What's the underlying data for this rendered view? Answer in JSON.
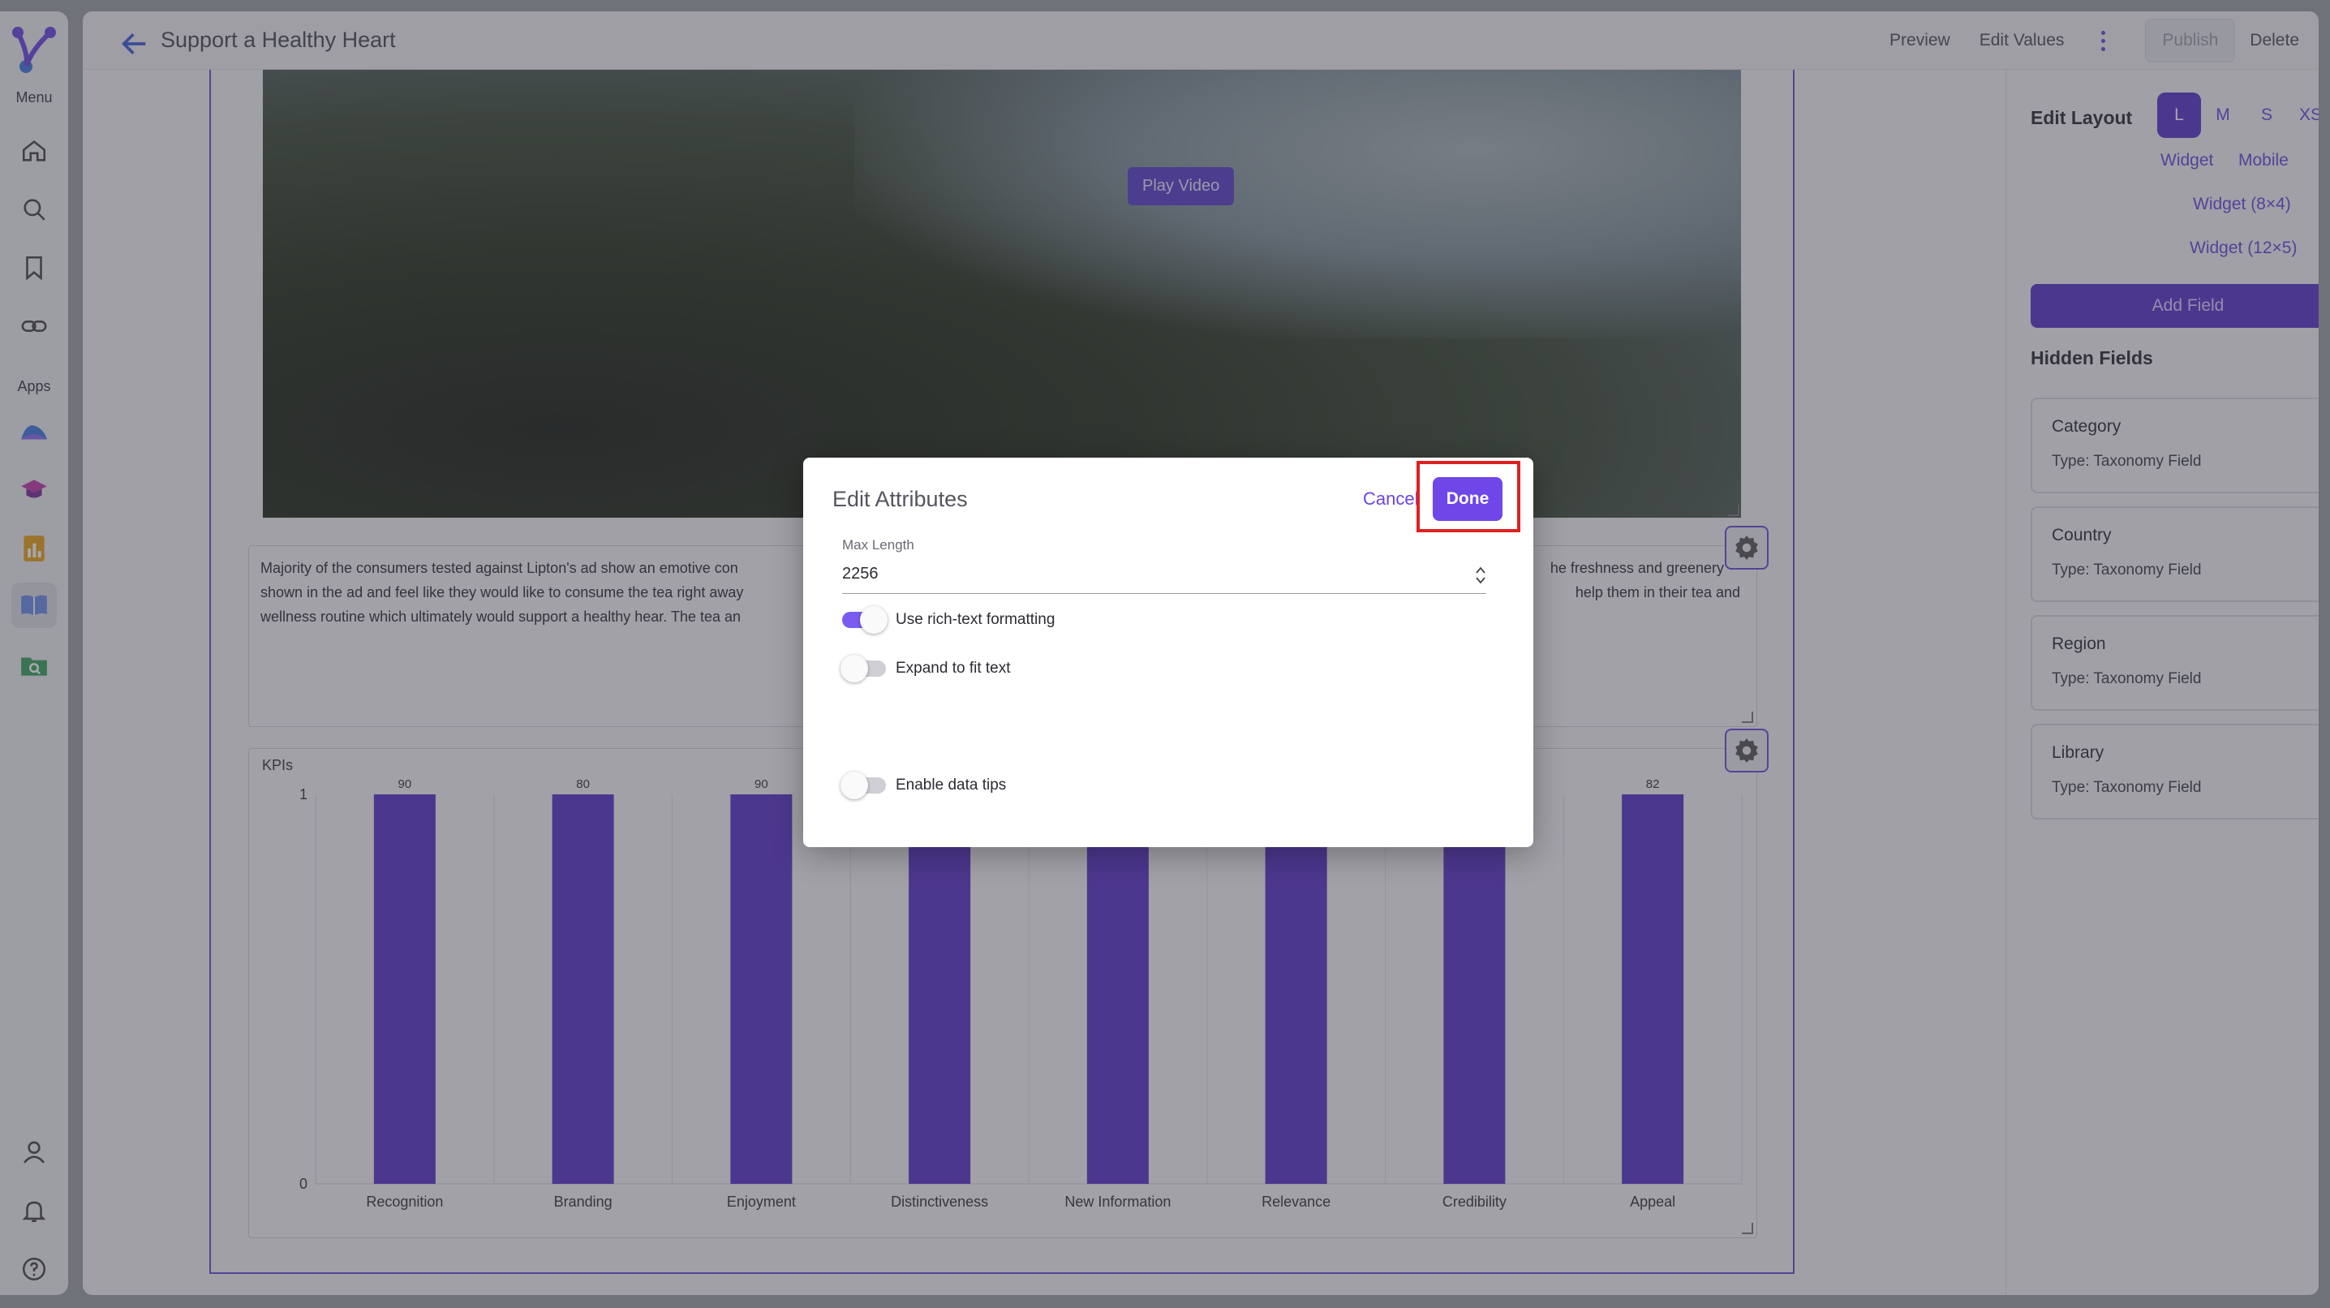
{
  "nav": {
    "menu_label": "Menu",
    "apps_label": "Apps",
    "menu_items": [
      "home-icon",
      "search-icon",
      "bookmark-icon",
      "link-icon"
    ],
    "app_items": [
      "wave-app-icon",
      "graduation-cap-app-icon",
      "bar-report-app-icon",
      "book-app-icon",
      "folder-search-app-icon"
    ],
    "bottom_items": [
      "user-icon",
      "bell-icon",
      "help-icon"
    ]
  },
  "header": {
    "title": "Support a Healthy Heart",
    "preview": "Preview",
    "edit_values": "Edit Values",
    "publish": "Publish",
    "delete": "Delete"
  },
  "content": {
    "play_video": "Play Video",
    "text_line1_left": "Majority of the consumers tested against Lipton's ad show an emotive con",
    "text_line1_right": "he freshness and greenery",
    "text_line2_left": "shown in the ad and feel like they would like to consume the tea right away",
    "text_line2_right": "help them in their tea and",
    "text_line3_left": "wellness routine which ultimately would support a healthy hear. The tea an",
    "kpi_label": "KPIs"
  },
  "chart_data": {
    "type": "bar",
    "title": "KPIs",
    "categories": [
      "Recognition",
      "Branding",
      "Enjoyment",
      "Distinctiveness",
      "New Information",
      "Relevance",
      "Credibility",
      "Appeal"
    ],
    "values": [
      90,
      80,
      90,
      null,
      null,
      null,
      null,
      82
    ],
    "y_tick_labels": [
      "1",
      "0"
    ],
    "bar_color": "#5a34c9",
    "grid": true
  },
  "right_panel": {
    "edit_layout": "Edit Layout",
    "sizes": [
      "L",
      "M",
      "S",
      "XS"
    ],
    "active_size": "L",
    "layout_links": [
      "Widget",
      "Mobile",
      "Widget (8×4)",
      "Widget (12×5)"
    ],
    "add_field": "Add Field",
    "hidden_fields_title": "Hidden Fields",
    "hidden_fields": [
      {
        "name": "Category",
        "type": "Type: Taxonomy Field"
      },
      {
        "name": "Country",
        "type": "Type: Taxonomy Field"
      },
      {
        "name": "Region",
        "type": "Type: Taxonomy Field"
      },
      {
        "name": "Library",
        "type": "Type: Taxonomy Field"
      }
    ]
  },
  "modal": {
    "title": "Edit Attributes",
    "cancel": "Cancel",
    "done": "Done",
    "max_length_label": "Max Length",
    "max_length_value": "2256",
    "toggles": [
      {
        "label": "Use rich-text formatting",
        "on": true
      },
      {
        "label": "Expand to fit text",
        "on": false
      },
      {
        "label": "Enable data tips",
        "on": false
      }
    ]
  },
  "colors": {
    "accent": "#6a46e0",
    "highlight": "#e02020"
  }
}
